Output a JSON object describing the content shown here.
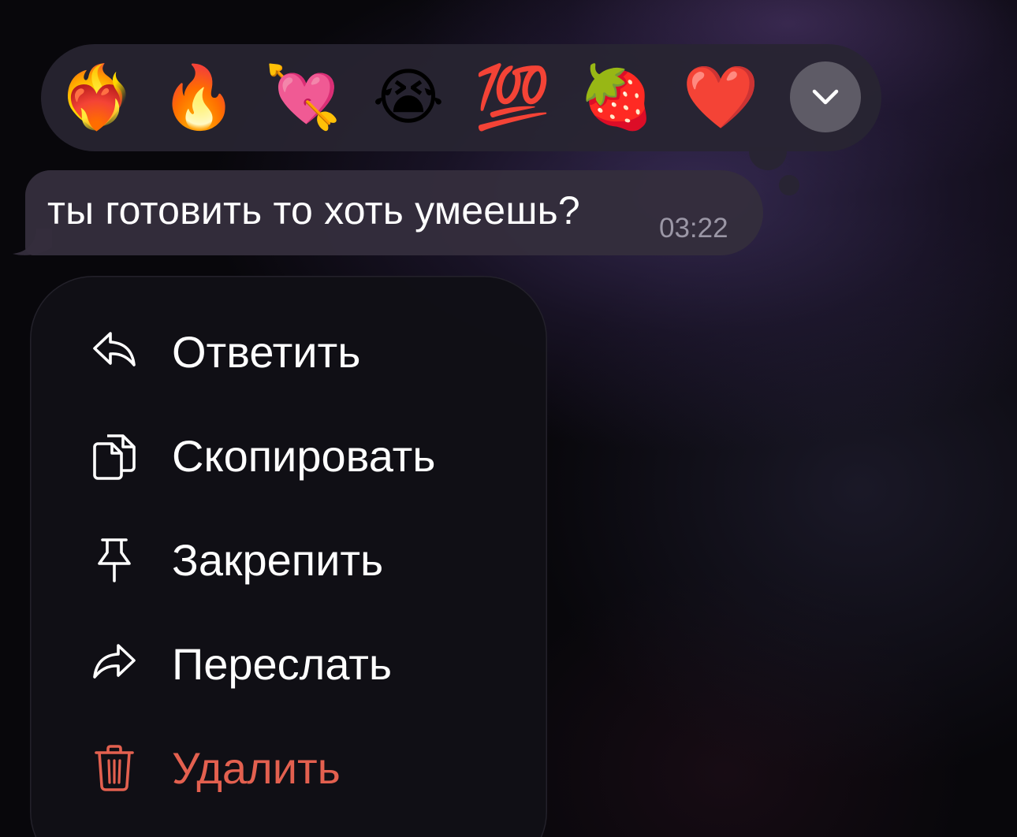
{
  "reactions": [
    {
      "emoji": "❤️‍🔥",
      "name": "heart-on-fire"
    },
    {
      "emoji": "🔥",
      "name": "fire"
    },
    {
      "emoji": "💘",
      "name": "heart-with-arrow"
    },
    {
      "emoji": "😭",
      "name": "loudly-crying-face"
    },
    {
      "emoji": "💯",
      "name": "hundred-points"
    },
    {
      "emoji": "🍓",
      "name": "strawberry"
    },
    {
      "emoji": "❤️",
      "name": "red-heart"
    }
  ],
  "more_button": {
    "icon": "chevron-down-icon"
  },
  "message": {
    "text": "ты готовить то хоть умеешь?",
    "time": "03:22"
  },
  "menu": {
    "items": [
      {
        "label": "Ответить",
        "icon": "reply-icon"
      },
      {
        "label": "Скопировать",
        "icon": "copy-icon"
      },
      {
        "label": "Закрепить",
        "icon": "pin-icon"
      },
      {
        "label": "Переслать",
        "icon": "forward-icon"
      },
      {
        "label": "Удалить",
        "icon": "trash-icon",
        "danger": true
      }
    ]
  },
  "colors": {
    "danger": "#e3604f",
    "menu_background": "#111016",
    "bubble_background": "#342e3c",
    "reaction_bar_background": "#282532"
  }
}
